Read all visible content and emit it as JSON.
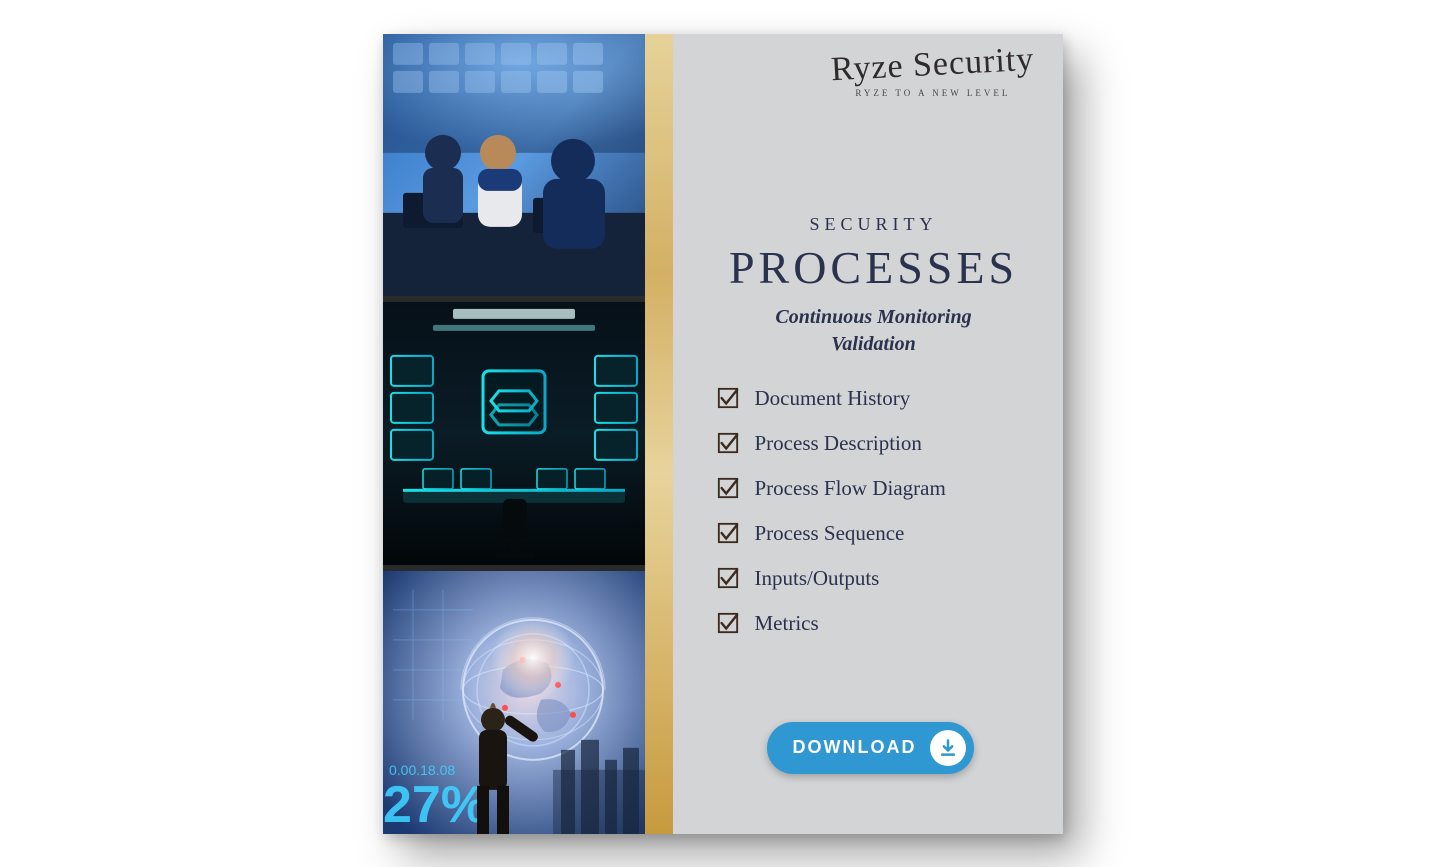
{
  "brand": {
    "logo_text": "Ryze Security",
    "tagline": "RYZE TO A NEW LEVEL"
  },
  "header": {
    "kicker": "SECURITY",
    "title": "PROCESSES",
    "subtitle_line1": "Continuous Monitoring",
    "subtitle_line2": "Validation"
  },
  "checklist": [
    {
      "label": "Document History"
    },
    {
      "label": "Process Description"
    },
    {
      "label": "Process Flow Diagram"
    },
    {
      "label": "Process Sequence"
    },
    {
      "label": "Inputs/Outputs"
    },
    {
      "label": "Metrics"
    }
  ],
  "button": {
    "label": "DOWNLOAD"
  },
  "left_images": {
    "overlay_number": "27%",
    "overlay_code": "0.00.18.08"
  },
  "colors": {
    "navy": "#2a324d",
    "gold": "#d3b064",
    "panel": "#d3d4d6",
    "button": "#2f97d1"
  }
}
